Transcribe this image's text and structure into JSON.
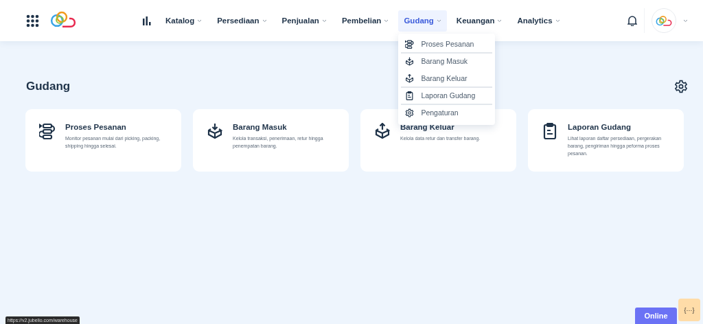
{
  "nav": [
    {
      "label": "Katalog",
      "selected": false
    },
    {
      "label": "Persediaan",
      "selected": false
    },
    {
      "label": "Penjualan",
      "selected": false
    },
    {
      "label": "Pembelian",
      "selected": false
    },
    {
      "label": "Gudang",
      "selected": true
    },
    {
      "label": "Keuangan",
      "selected": false
    },
    {
      "label": "Analytics",
      "selected": false
    }
  ],
  "dropdown": [
    {
      "label": "Proses Pesanan",
      "divider": true
    },
    {
      "label": "Barang Masuk",
      "divider": false
    },
    {
      "label": "Barang Keluar",
      "divider": true
    },
    {
      "label": "Laporan Gudang",
      "divider": true
    },
    {
      "label": "Pengaturan",
      "divider": false
    }
  ],
  "page_title": "Gudang",
  "cards": [
    {
      "title": "Proses Pesanan",
      "description": "Monitor pesanan mulai dari picking, packing, shipping hingga selesai."
    },
    {
      "title": "Barang Masuk",
      "description": "Kelola transaksi, penerimaan, retur hingga penempatan barang."
    },
    {
      "title": "Barang Keluar",
      "description": "Kelola data retur dan transfer barang."
    },
    {
      "title": "Laporan Gudang",
      "description": "Lihat laporan daftar persediaan, pergerakan barang, pengiriman hingga peforma proses pesanan."
    }
  ],
  "status_url": "https://v2.jubelio.com/warehouse",
  "online_button": "Online",
  "dev_badge": "{···}"
}
